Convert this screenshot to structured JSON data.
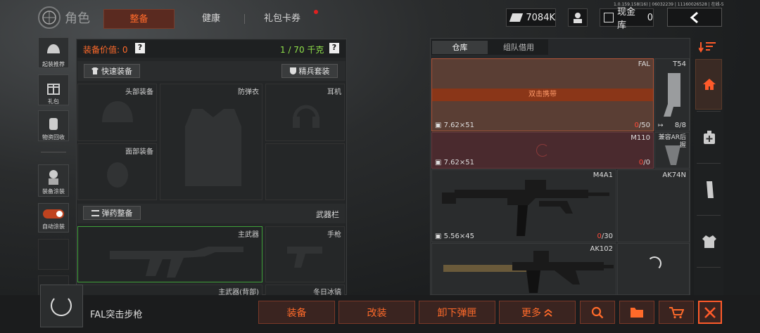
{
  "header": {
    "title": "角色",
    "tabs": [
      {
        "label": "整备",
        "active": true
      },
      {
        "label": "健康",
        "active": false
      },
      {
        "label": "礼包卡券",
        "active": false
      }
    ],
    "currency": "7084K",
    "cash_label": "现金库",
    "cash_value": "0",
    "version": "1.0.159.158(16) | 06032239 | 11160026528 | 在线-5"
  },
  "left_sidebar": {
    "items": [
      {
        "label": "起装推荐"
      },
      {
        "label": "礼包"
      },
      {
        "label": "物资回收"
      },
      {
        "label": "装备涂装"
      },
      {
        "label": "自动涂装"
      }
    ]
  },
  "equipment": {
    "value_label": "装备价值: 0",
    "weight": "1 / 70 千克",
    "help": "?",
    "quick_equip": "快速装备",
    "elite_set": "精兵套装",
    "slots": {
      "head": "头部装备",
      "armor": "防弹衣",
      "ear": "耳机",
      "face": "面部装备"
    },
    "ammo_button": "弹药整备",
    "weapon_bar": "武器栏",
    "primary": "主武器",
    "pistol": "手枪",
    "primary_back": "主武器(背部)",
    "melee": "冬日冰镐"
  },
  "storage": {
    "tabs": [
      {
        "label": "仓库",
        "active": true
      },
      {
        "label": "组队借用",
        "active": false
      }
    ],
    "items": [
      {
        "name": "FAL",
        "ammo": "7.62×51",
        "count_red": "0",
        "count_total": "/50",
        "banner": "双击携带"
      },
      {
        "name": "T54",
        "count": "8/8"
      },
      {
        "name": "M110",
        "ammo": "7.62×51",
        "count_red": "0",
        "count_total": "/0"
      },
      {
        "name": "兼容AR后握"
      },
      {
        "name": "M4A1",
        "ammo": "5.56×45",
        "count_red": "0",
        "count_total": "/30"
      },
      {
        "name": "AK74N"
      },
      {
        "name": "AK102"
      }
    ]
  },
  "bottom": {
    "selected_item": "FAL突击步枪",
    "buttons": [
      "装备",
      "改装",
      "卸下弹匣",
      "更多"
    ]
  }
}
